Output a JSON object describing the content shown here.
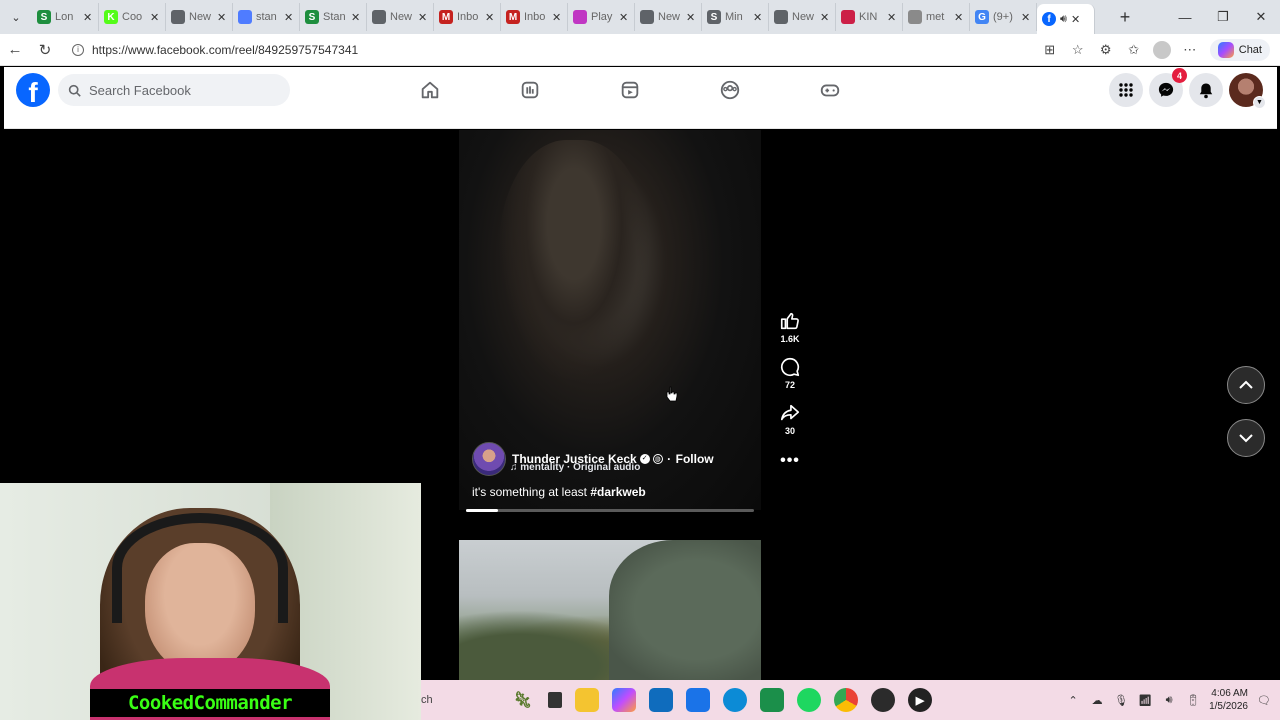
{
  "browser": {
    "tabs": [
      {
        "label": "Lon",
        "favicon_letter": "S",
        "favicon_color": "#1e8e3e"
      },
      {
        "label": "Coo",
        "favicon_letter": "K",
        "favicon_color": "#53fc18"
      },
      {
        "label": "New",
        "favicon_letter": "",
        "favicon_color": "#5f6368"
      },
      {
        "label": "stan",
        "favicon_letter": "",
        "favicon_color": "#4f7cff"
      },
      {
        "label": "Stan",
        "favicon_letter": "S",
        "favicon_color": "#1e8e3e"
      },
      {
        "label": "New",
        "favicon_letter": "",
        "favicon_color": "#5f6368"
      },
      {
        "label": "Inbo",
        "favicon_letter": "M",
        "favicon_color": "#c5221f"
      },
      {
        "label": "Inbo",
        "favicon_letter": "M",
        "favicon_color": "#c5221f"
      },
      {
        "label": "Play",
        "favicon_letter": "",
        "favicon_color": "#c036c3"
      },
      {
        "label": "New",
        "favicon_letter": "",
        "favicon_color": "#5f6368"
      },
      {
        "label": "Min",
        "favicon_letter": "S",
        "favicon_color": "#5f6368"
      },
      {
        "label": "New",
        "favicon_letter": "",
        "favicon_color": "#5f6368"
      },
      {
        "label": "KIN",
        "favicon_letter": "",
        "favicon_color": "#cc1f47"
      },
      {
        "label": "met",
        "favicon_letter": "",
        "favicon_color": "#8a8a8a"
      },
      {
        "label": "(9+)",
        "favicon_letter": "G",
        "favicon_color": "#4285f4"
      }
    ],
    "active_tab_favicon_color": "#0866ff",
    "url": "https://www.facebook.com/reel/849259757547341",
    "copilot_label": "Chat"
  },
  "facebook": {
    "search_placeholder": "Search Facebook",
    "messenger_badge": "4",
    "brand_color": "#0866ff"
  },
  "reel": {
    "author": "Thunder Justice Keck",
    "follow_label": "Follow",
    "separator": "·",
    "audio": "mentality · Original audio",
    "caption_text": "it's something at least ",
    "caption_tag": "#darkweb",
    "progress_fraction": 0.11,
    "likes": "1.6K",
    "comments": "72",
    "shares": "30",
    "more_label": "•••"
  },
  "webcam": {
    "streamer_name": "CookedCommander"
  },
  "taskbar": {
    "search_tail": "ch",
    "time": "4:06 AM",
    "date": "1/5/2026"
  }
}
